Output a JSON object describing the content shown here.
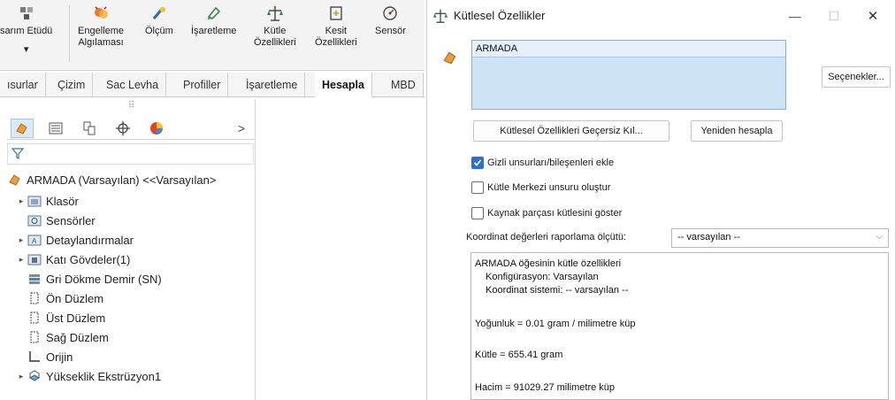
{
  "ribbon": {
    "partial_left_label": "sarım Etüdü",
    "buttons": [
      {
        "line1": "Engelleme",
        "line2": "Algılaması"
      },
      {
        "line1": "Ölçüm",
        "line2": ""
      },
      {
        "line1": "İşaretleme",
        "line2": ""
      },
      {
        "line1": "Kütle",
        "line2": "Özellikleri"
      },
      {
        "line1": "Kesit",
        "line2": "Özellikleri"
      },
      {
        "line1": "Sensör",
        "line2": ""
      }
    ],
    "partial_left_dropdown": "▾"
  },
  "tabs": {
    "items": [
      "ısurlar",
      "Çizim",
      "Sac Levha",
      "Profiller",
      "İşaretleme",
      "Hesapla",
      "MBD"
    ],
    "active": "Hesapla"
  },
  "feature_manager": {
    "grip": "⠿",
    "tab_icons": [
      "part-config-icon",
      "property-manager-icon",
      "configuration-manager-icon",
      "dimxpert-icon",
      "display-manager-icon"
    ],
    "more": ">",
    "filter_icon": "filter-icon",
    "root": "ARMADA (Varsayılan) <<Varsayılan>",
    "nodes": [
      {
        "label": "Klasör",
        "expandable": true
      },
      {
        "label": "Sensörler",
        "expandable": false
      },
      {
        "label": "Detaylandırmalar",
        "expandable": true
      },
      {
        "label": "Katı Gövdeler(1)",
        "expandable": true
      },
      {
        "label": "Gri Dökme Demir (SN)",
        "expandable": false
      },
      {
        "label": "Ön Düzlem",
        "expandable": false
      },
      {
        "label": "Üst Düzlem",
        "expandable": false
      },
      {
        "label": "Sağ Düzlem",
        "expandable": false
      },
      {
        "label": "Orijin",
        "expandable": false
      },
      {
        "label": "Yükseklik Ekstrüzyon1",
        "expandable": true
      }
    ]
  },
  "dialog": {
    "title": "Kütlesel Özellikler",
    "minimize": "—",
    "maximize": "☐",
    "close": "✕",
    "selection_item": "ARMADA",
    "options_button": "Seçenekler...",
    "override_button": "Kütlesel Özellikleri Geçersiz Kıl...",
    "recalculate_button": "Yeniden hesapla",
    "checkboxes": [
      {
        "label": "Gizli unsurları/bileşenleri ekle",
        "checked": true
      },
      {
        "label": "Kütle Merkezi unsuru oluştur",
        "checked": false
      },
      {
        "label": "Kaynak parçası kütlesini göster",
        "checked": false
      }
    ],
    "coord_label": "Koordinat değerleri raporlama ölçütü:",
    "coord_value": "-- varsayılan --",
    "results": {
      "header": "ARMADA öğesinin kütle özellikleri",
      "config": "Konfigürasyon: Varsayılan",
      "coord_system": "Koordinat sistemi: -- varsayılan --",
      "density": "Yoğunluk = 0.01 gram / milimetre küp",
      "mass": "Kütle = 655.41 gram",
      "volume": "Hacim = 91029.27 milimetre küp"
    }
  },
  "colors": {
    "accent": "#2f6fce",
    "selection_bg": "#cfe3f7",
    "ribbon_bg": "#f3f3f3"
  }
}
